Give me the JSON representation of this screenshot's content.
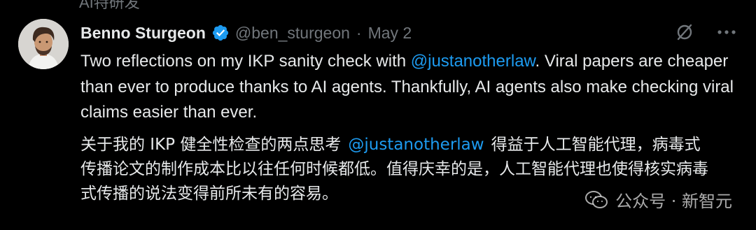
{
  "previous": {
    "cut_text": "AI特研发"
  },
  "tweet": {
    "author_name": "Benno Sturgeon",
    "handle": "@ben_sturgeon",
    "separator": "·",
    "date": "May 2",
    "text_parts": [
      "Two reflections on my IKP sanity check with ",
      "@justanotherlaw",
      ". Viral papers are cheaper than ever to produce thanks to AI agents. Thankfully, AI agents also make checking viral claims easier than ever."
    ],
    "translation_parts": [
      "关于我的 IKP 健全性检查的两点思考",
      "@justanotherlaw",
      "得益于人工智能代理，病毒式传播论文的制作成本比以往任何时候都低。值得庆幸的是，人工智能代理也使得核实病毒式传播的说法变得前所未有的容易。"
    ]
  },
  "watermark": {
    "text": "公众号 · 新智元"
  },
  "icons": {
    "verified": "verified-badge-icon",
    "grok": "grok-icon",
    "more": "more-horizontal-icon",
    "watermark": "wechat-logo-icon"
  },
  "colors": {
    "background": "#000000",
    "text": "#e7e9ea",
    "secondary": "#71767b",
    "accent": "#1d9bf0"
  }
}
